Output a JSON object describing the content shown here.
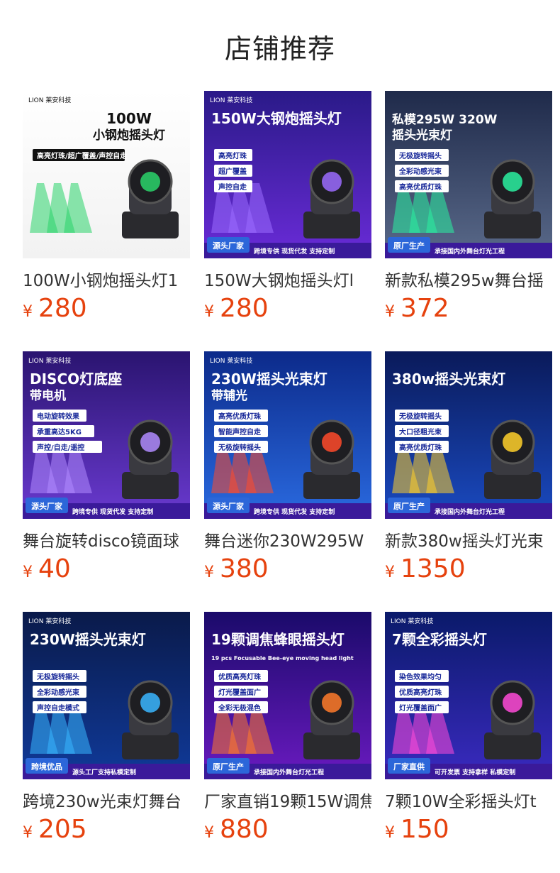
{
  "header": {
    "title": "店铺推荐"
  },
  "currency_symbol": "¥",
  "products": [
    {
      "name": "100W小钢炮摇头灯1",
      "price": "280",
      "image_text": {
        "brand": "LION 莱安科技",
        "headline": "100W",
        "headline2": "小钢炮摇头灯",
        "tags": [
          "高亮灯珠/超广覆盖/声控自走"
        ],
        "footer_badge": "",
        "footer_text": ""
      }
    },
    {
      "name": "150W大钢炮摇头灯l",
      "price": "280",
      "image_text": {
        "brand": "LION 莱安科技",
        "headline": "150W大钢炮摇头灯",
        "headline2": "",
        "tags": [
          "高亮灯珠",
          "超广覆盖",
          "声控自走"
        ],
        "footer_badge": "源头厂家",
        "footer_text": "跨境专供  现货代发  支持定制"
      }
    },
    {
      "name": "新款私模295w舞台摇",
      "price": "372",
      "image_text": {
        "brand": "",
        "headline": "私模295W 320W",
        "headline2": "摇头光束灯",
        "tags": [
          "无极旋转摇头",
          "全彩动感光束",
          "高亮优质灯珠"
        ],
        "footer_badge": "原厂生产",
        "footer_text": "承接国内外舞台灯光工程"
      }
    },
    {
      "name": "舞台旋转disco镜面球",
      "price": "40",
      "image_text": {
        "brand": "LION 莱安科技",
        "headline": "DISCO灯底座",
        "headline2": "带电机",
        "tags": [
          "电动旋转效果",
          "承重高达5KG",
          "声控/自走/遥控"
        ],
        "footer_badge": "源头厂家",
        "footer_text": "跨境专供  现货代发  支持定制"
      }
    },
    {
      "name": "舞台迷你230W295W",
      "price": "380",
      "image_text": {
        "brand": "LION 莱安科技",
        "headline": "230W摇头光束灯",
        "headline2": "带辅光",
        "tags": [
          "高亮优质灯珠",
          "智能声控自走",
          "无极旋转摇头"
        ],
        "footer_badge": "源头厂家",
        "footer_text": "跨境专供  现货代发  支持定制"
      }
    },
    {
      "name": "新款380w摇头灯光束",
      "price": "1350",
      "image_text": {
        "brand": "",
        "headline": "380w摇头光束灯",
        "headline2": "",
        "tags": [
          "无极旋转摇头",
          "大口径粗光束",
          "高亮优质灯珠"
        ],
        "footer_badge": "原厂生产",
        "footer_text": "承接国内外舞台灯光工程"
      }
    },
    {
      "name": "跨境230w光束灯舞台",
      "price": "205",
      "image_text": {
        "brand": "LION 莱安科技",
        "headline": "230W摇头光束灯",
        "headline2": "",
        "tags": [
          "无极旋转摇头",
          "全彩动感光束",
          "声控自走模式"
        ],
        "footer_badge": "跨境优品",
        "footer_text": "源头工厂支持私模定制"
      }
    },
    {
      "name": "厂家直销19颗15W调焦",
      "price": "880",
      "image_text": {
        "brand": "",
        "headline": "19颗调焦蜂眼摇头灯",
        "headline2": "19 pcs Focusable Bee-eye moving head light",
        "tags": [
          "优质高亮灯珠",
          "灯光覆盖面广",
          "全彩无极混色"
        ],
        "footer_badge": "原厂生产",
        "footer_text": "承接国内外舞台灯光工程"
      }
    },
    {
      "name": "7颗10W全彩摇头灯t",
      "price": "150",
      "image_text": {
        "brand": "LION 莱安科技",
        "headline": "7颗全彩摇头灯",
        "headline2": "",
        "tags": [
          "染色效果均匀",
          "优质高亮灯珠",
          "灯光覆盖面广"
        ],
        "footer_badge": "厂家直供",
        "footer_text": "可开发票  支持拿样  私模定制"
      }
    }
  ],
  "colors": {
    "price": "#e6420e",
    "card_bg_dark": "#1a1f6b",
    "card_bg_purple": "#5a2bb8",
    "badge_blue": "#2c66d9"
  }
}
